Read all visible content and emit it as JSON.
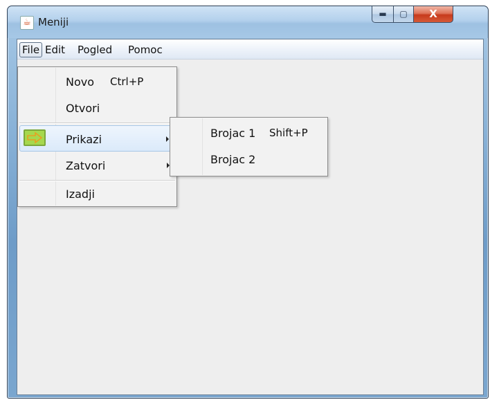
{
  "window": {
    "title": "Meniji",
    "app_icon": "java-cup-icon",
    "controls": {
      "minimize": "minimize-icon",
      "maximize": "maximize-icon",
      "close_label": "X"
    }
  },
  "menubar": {
    "items": [
      {
        "label": "File"
      },
      {
        "label": "Edit"
      },
      {
        "label": "Pogled"
      },
      {
        "label": "Pomoc"
      }
    ]
  },
  "file_menu": {
    "items": [
      {
        "label": "Novo",
        "accelerator": "Ctrl+P"
      },
      {
        "label": "Otvori"
      },
      {
        "label": "Prikazi",
        "icon": "green-arrow-icon",
        "has_submenu": true,
        "highlighted": true
      },
      {
        "label": "Zatvori",
        "has_submenu": true
      },
      {
        "label": "Izadji"
      }
    ]
  },
  "prikazi_submenu": {
    "items": [
      {
        "label": "Brojac 1",
        "accelerator": "Shift+P"
      },
      {
        "label": "Brojac 2"
      }
    ]
  },
  "colors": {
    "menu_highlight": "#dbeafa",
    "icon_green": "#a6d84e",
    "close_button": "#c73a1c"
  }
}
